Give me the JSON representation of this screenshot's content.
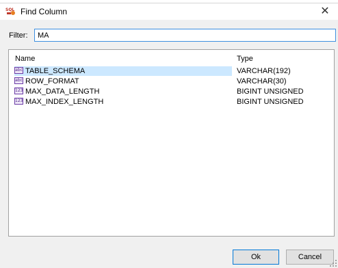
{
  "window": {
    "title": "Find Column",
    "close_glyph": "✕",
    "app_icon": "sql-icon"
  },
  "filter": {
    "label": "Filter:",
    "value": "MA"
  },
  "list": {
    "columns": {
      "name": "Name",
      "type": "Type"
    },
    "rows": [
      {
        "name": "TABLE_SCHEMA",
        "type": "VARCHAR(192)",
        "icon": "text-type-icon",
        "icon_text": "abc",
        "selected": true
      },
      {
        "name": "ROW_FORMAT",
        "type": "VARCHAR(30)",
        "icon": "text-type-icon",
        "icon_text": "abc",
        "selected": false
      },
      {
        "name": "MAX_DATA_LENGTH",
        "type": "BIGINT UNSIGNED",
        "icon": "numeric-type-icon",
        "icon_text": "123",
        "selected": false
      },
      {
        "name": "MAX_INDEX_LENGTH",
        "type": "BIGINT UNSIGNED",
        "icon": "numeric-type-icon",
        "icon_text": "123",
        "selected": false
      }
    ]
  },
  "buttons": {
    "ok": "Ok",
    "cancel": "Cancel"
  },
  "colors": {
    "selection": "#cce8ff",
    "focus_border": "#3d8fe0"
  }
}
